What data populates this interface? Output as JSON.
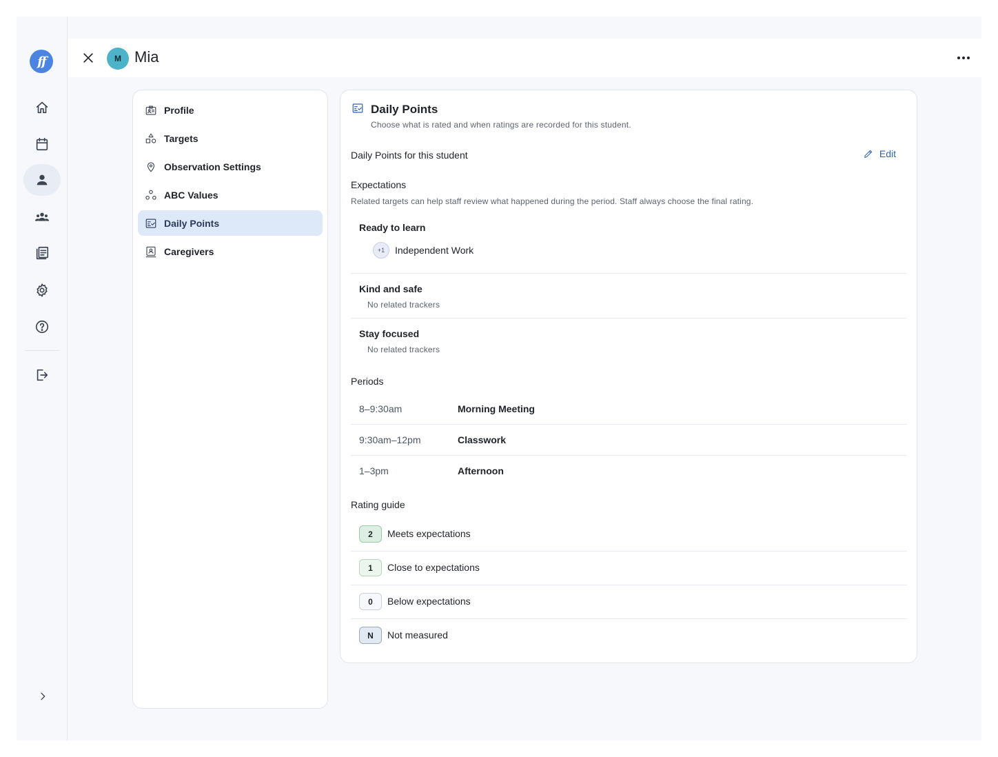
{
  "app": {
    "logo_text": "ff",
    "rail": [
      {
        "icon": "home-icon"
      },
      {
        "icon": "calendar-icon"
      },
      {
        "icon": "person-icon",
        "active": true
      },
      {
        "icon": "group-icon"
      },
      {
        "icon": "library-icon"
      },
      {
        "icon": "gear-icon"
      },
      {
        "icon": "help-icon"
      },
      {
        "icon": "logout-icon"
      }
    ]
  },
  "header": {
    "avatar_initial": "M",
    "student_name": "Mia"
  },
  "menu": {
    "items": [
      {
        "label": "Profile",
        "icon": "id-card-icon"
      },
      {
        "label": "Targets",
        "icon": "shapes-icon"
      },
      {
        "label": "Observation Settings",
        "icon": "location-pin-icon"
      },
      {
        "label": "ABC Values",
        "icon": "nodes-icon"
      },
      {
        "label": "Daily Points",
        "icon": "checklist-icon",
        "active": true
      },
      {
        "label": "Caregivers",
        "icon": "contact-card-icon"
      }
    ]
  },
  "card": {
    "title": "Daily Points",
    "subtitle": "Choose what is rated and when ratings are recorded for this student.",
    "section_label": "Daily Points for this student",
    "edit_label": "Edit",
    "expectations": {
      "heading": "Expectations",
      "description": "Related targets can help staff review what happened during the period. Staff always choose the final rating.",
      "items": [
        {
          "name": "Ready to learn",
          "tracker_badge": "+1",
          "tracker_label": "Independent Work"
        },
        {
          "name": "Kind and safe",
          "note": "No related trackers"
        },
        {
          "name": "Stay focused",
          "note": "No related trackers"
        }
      ]
    },
    "periods": {
      "heading": "Periods",
      "items": [
        {
          "time": "8–9:30am",
          "name": "Morning Meeting"
        },
        {
          "time": "9:30am–12pm",
          "name": "Classwork"
        },
        {
          "time": "1–3pm",
          "name": "Afternoon"
        }
      ]
    },
    "rating_guide": {
      "heading": "Rating guide",
      "items": [
        {
          "value": "2",
          "label": "Meets expectations",
          "bg": "#dcefe2",
          "border": "#9cc9a8"
        },
        {
          "value": "1",
          "label": "Close to expectations",
          "bg": "#edf6ee",
          "border": "#b4d6bb"
        },
        {
          "value": "0",
          "label": "Below expectations",
          "bg": "#f6f8fb",
          "border": "#c9d1dc"
        },
        {
          "value": "N",
          "label": "Not measured",
          "bg": "#e3e9f3",
          "border": "#9aa8c0"
        }
      ]
    }
  },
  "colors": {
    "accent": "#2e62b8",
    "active_menu_bg": "#dde9f9",
    "avatar_bg": "#4cb3c8",
    "logo_bg": "#4a83e0"
  }
}
